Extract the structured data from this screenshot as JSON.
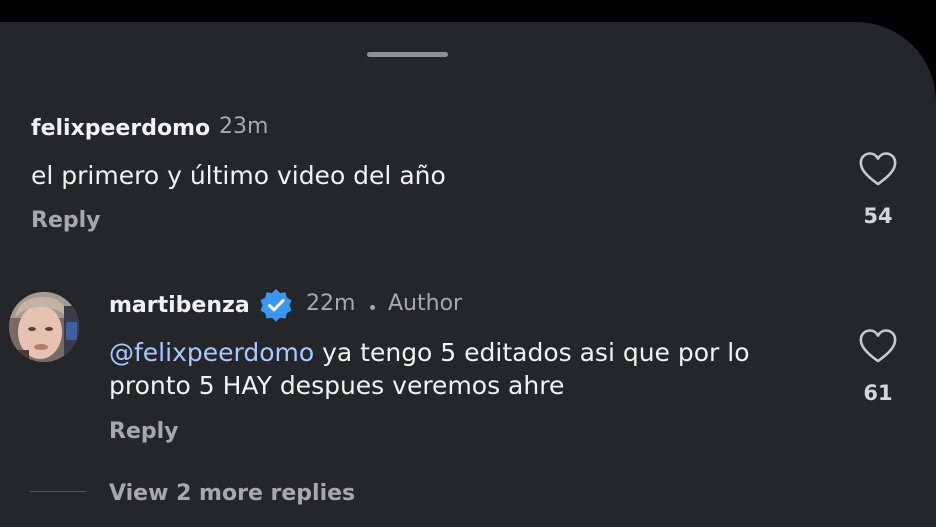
{
  "comments": [
    {
      "username": "felixpeerdomo",
      "time": "23m",
      "text": "el primero y último video del año",
      "reply_label": "Reply",
      "likes": "54"
    },
    {
      "username": "martibenza",
      "time": "22m",
      "author_label": "Author",
      "mention": "@felixpeerdomo",
      "text_line1": " ya tengo 5 editados asi que por lo",
      "text_line2": "pronto 5 HAY despues veremos ahre",
      "reply_label": "Reply",
      "likes": "61"
    }
  ],
  "view_more_label": "View 2 more replies",
  "colors": {
    "background": "#000000",
    "sheet": "#25262a",
    "mention": "#a9c8ff",
    "verified": "#3897f0"
  }
}
